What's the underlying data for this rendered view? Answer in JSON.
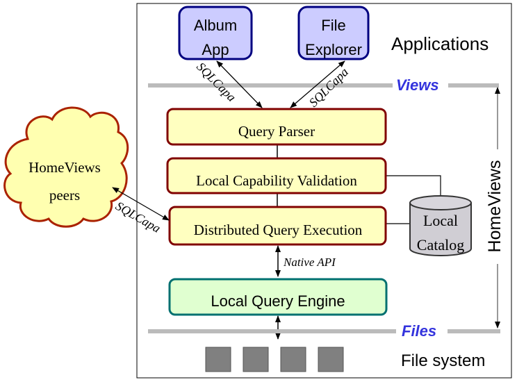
{
  "apps": [
    {
      "line1": "Album",
      "line2": "App"
    },
    {
      "line1": "File",
      "line2": "Explorer"
    }
  ],
  "labels": {
    "applications": "Applications",
    "views": "Views",
    "files": "Files",
    "file_system": "File system",
    "homeviews": "HomeViews",
    "sqlcapa": "SQLCapa",
    "native_api": "Native API"
  },
  "layers": {
    "query_parser": "Query Parser",
    "capability_validation": "Local Capability Validation",
    "distributed_execution": "Distributed Query Execution",
    "query_engine": "Local Query Engine"
  },
  "catalog": {
    "line1": "Local",
    "line2": "Catalog"
  },
  "peers": {
    "line1": "HomeViews",
    "line2": "peers"
  },
  "colors": {
    "app_fill": "#ccccff",
    "app_stroke": "#000080",
    "layer_fill": "#ffffc0",
    "layer_stroke": "#800000",
    "engine_fill": "#e0ffd0",
    "engine_stroke": "#007070",
    "accent_blue": "#3333dd",
    "bar_gray": "#bbbbbb",
    "file_gray": "#808080"
  }
}
